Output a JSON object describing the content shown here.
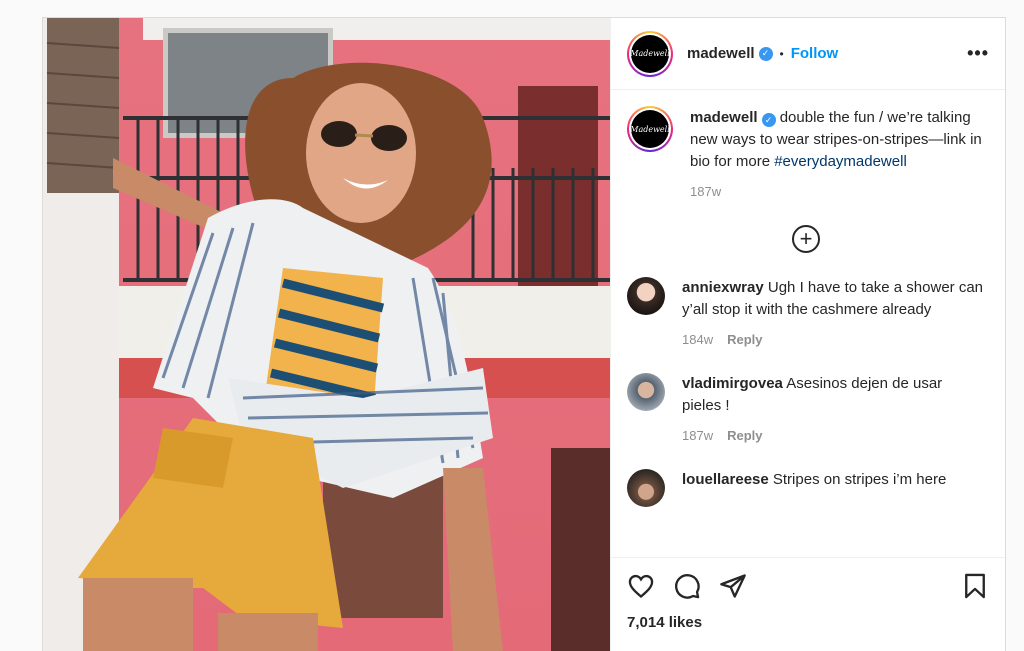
{
  "post": {
    "username": "madewell",
    "follow_label": "Follow",
    "separator": "•",
    "avatar_text": "Madewell",
    "caption": {
      "username": "madewell",
      "text": " double the fun / we’re talking new ways to wear stripes-on-stripes—link in bio for more ",
      "hashtag": "#everydaymadewell",
      "time": "187w"
    },
    "comments": [
      {
        "username": "anniexwray",
        "text": " Ugh I have to take a shower can y’all stop it with the cashmere already",
        "time": "184w",
        "reply": "Reply"
      },
      {
        "username": "vladimirgovea",
        "text": " Asesinos dejen de usar pieles !",
        "time": "187w",
        "reply": "Reply"
      },
      {
        "username": "louellareese",
        "text": " Stripes on stripes i’m here",
        "time": "",
        "reply": ""
      }
    ],
    "likes": "7,014 likes"
  },
  "icons": [
    "verified-badge-icon",
    "more-options-icon",
    "load-more-plus-icon",
    "heart-icon",
    "comment-icon",
    "share-icon",
    "bookmark-icon"
  ],
  "colors": {
    "link": "#0095f6",
    "hashtag": "#00376b",
    "muted": "#8e8e8e",
    "verified": "#3897f0"
  }
}
